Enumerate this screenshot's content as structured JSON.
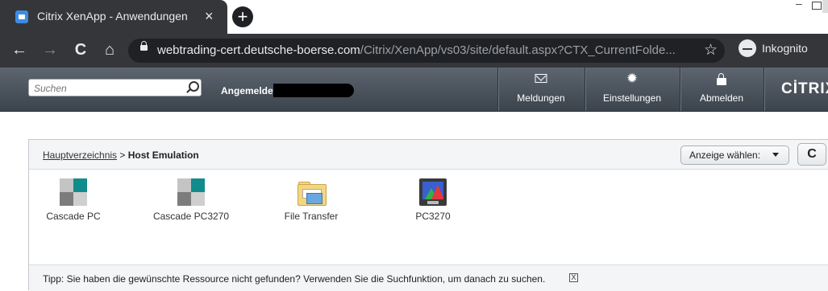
{
  "browser": {
    "tab_title": "Citrix XenApp - Anwendungen",
    "tab_close": "×",
    "new_tab": "+",
    "url_host": "webtrading-cert.deutsche-boerse.com",
    "url_path": "/Citrix/XenApp/vs03/site/default.aspx?CTX_CurrentFolde...",
    "bookmark": "☆",
    "incognito_label": "Inkognito",
    "back": "←",
    "forward": "→",
    "reload": "C",
    "home": "⌂"
  },
  "header": {
    "search_placeholder": "Suchen",
    "logged_in_label": "Angemeldet als: HO",
    "actions": [
      {
        "label": "Meldungen",
        "icon": "mail-icon"
      },
      {
        "label": "Einstellungen",
        "icon": "gear-icon"
      },
      {
        "label": "Abmelden",
        "icon": "lock-icon"
      }
    ],
    "logo": "CİTRIX"
  },
  "panel": {
    "breadcrumb_root": "Hauptverzeichnis",
    "breadcrumb_sep": " > ",
    "breadcrumb_current": "Host Emulation",
    "view_button": "Anzeige wählen:",
    "refresh": "C",
    "apps": [
      {
        "label": "Cascade PC",
        "icon": "cascade-icon"
      },
      {
        "label": "Cascade PC3270",
        "icon": "cascade-icon"
      },
      {
        "label": "File Transfer",
        "icon": "folder-icon"
      },
      {
        "label": "PC3270",
        "icon": "monitor-icon"
      }
    ],
    "tip": "Tipp: Sie haben die gewünschte Ressource nicht gefunden? Verwenden Sie die Suchfunktion, um danach zu suchen.",
    "tip_close": "X"
  }
}
